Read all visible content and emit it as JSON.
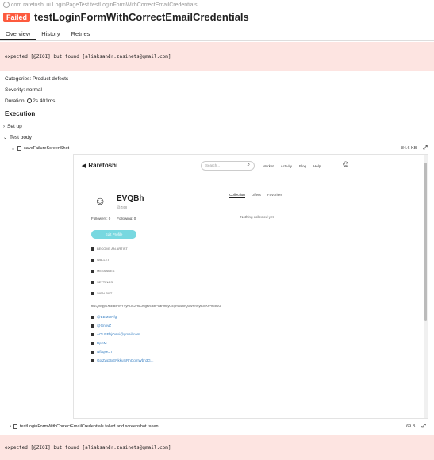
{
  "breadcrumb": "com.raretoshi.ui.LoginPageTest.testLoginFormWithCorrectEmailCredentials",
  "status": "Failed",
  "title": "testLoginFormWithCorrectEmailCredentials",
  "tabs": [
    "Overview",
    "History",
    "Retries"
  ],
  "error_message": "expected [@ZIOI] but found [aliaksandr.zasinets@gmail.com]",
  "categories": "Categories: Product defects",
  "severity": "Severity: normal",
  "duration_label": "Duration:",
  "duration_value": "2s 401ms",
  "execution": {
    "title": "Execution",
    "setup": "Set up",
    "test_body": "Test body",
    "attachment_name": "saveFailureScreenShot",
    "attachment_size": "84.6 KB",
    "step2_name": "testLoginFormWithCorrectEmailCredentials failed and screenshot taken!",
    "step2_size": "69 B"
  },
  "screenshot": {
    "logo": "Raretoshi",
    "search_placeholder": "Search...",
    "nav": [
      "Market",
      "Activity",
      "Blog",
      "Help"
    ],
    "profile_name": "EVQBh",
    "profile_handle": "@ZIOI",
    "followers": "Followers: 0",
    "following": "Following: 0",
    "edit_button": "Edit Profile",
    "menu": [
      "BECOME AN ARTIST",
      "WALLET",
      "MESSAGES",
      "SETTINGS",
      "SIGN OUT"
    ],
    "wallet_address": "tb1Q9vqyGXkEBxRNYYyNDC2H6Cf6gsvGkbPoaPmLyGEgm44fkrQuWRhSykuVKrPmdiUU",
    "socials": [
      "@EBMMNfg",
      "@GnnvZ",
      "AOUSEhjOAoi@gmail.com",
      "DpKM",
      "wfbqsKLT",
      "GpiZwp3xENkkuIxRhQgmWbn3G..."
    ],
    "profile_tabs": [
      "Collection",
      "Offers",
      "Favorites"
    ],
    "empty_message": "Nothing collected yet"
  },
  "colors": {
    "failed": "#fd5a3e",
    "error_bg": "#fde4e1",
    "edit_button": "#78d8e0",
    "link": "#3b82c4"
  }
}
